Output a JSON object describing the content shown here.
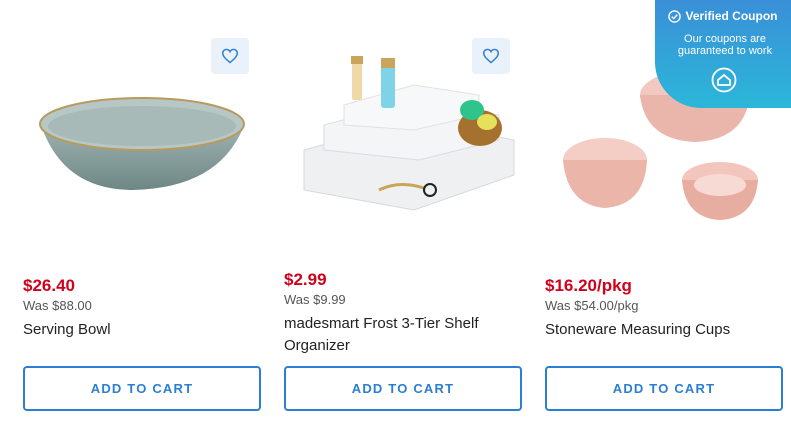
{
  "products": [
    {
      "price": "$26.40",
      "was": "Was $88.00",
      "name": "Serving Bowl",
      "cta": "ADD TO CART"
    },
    {
      "price": "$2.99",
      "was": "Was $9.99",
      "name": "madesmart Frost 3-Tier Shelf Organizer",
      "cta": "ADD TO CART"
    },
    {
      "price": "$16.20/pkg",
      "was": "Was $54.00/pkg",
      "name": "Stoneware Measuring Cups",
      "cta": "ADD TO CART"
    }
  ],
  "coupon": {
    "title": "Verified Coupon",
    "subtitle": "Our coupons are guaranteed to work"
  },
  "colors": {
    "accent": "#2a7fd4",
    "price": "#d0021b",
    "coupon_bg": "#3a8fd8"
  },
  "icons": [
    "heart-icon",
    "checkmark-circle-icon",
    "house-logo-icon"
  ]
}
